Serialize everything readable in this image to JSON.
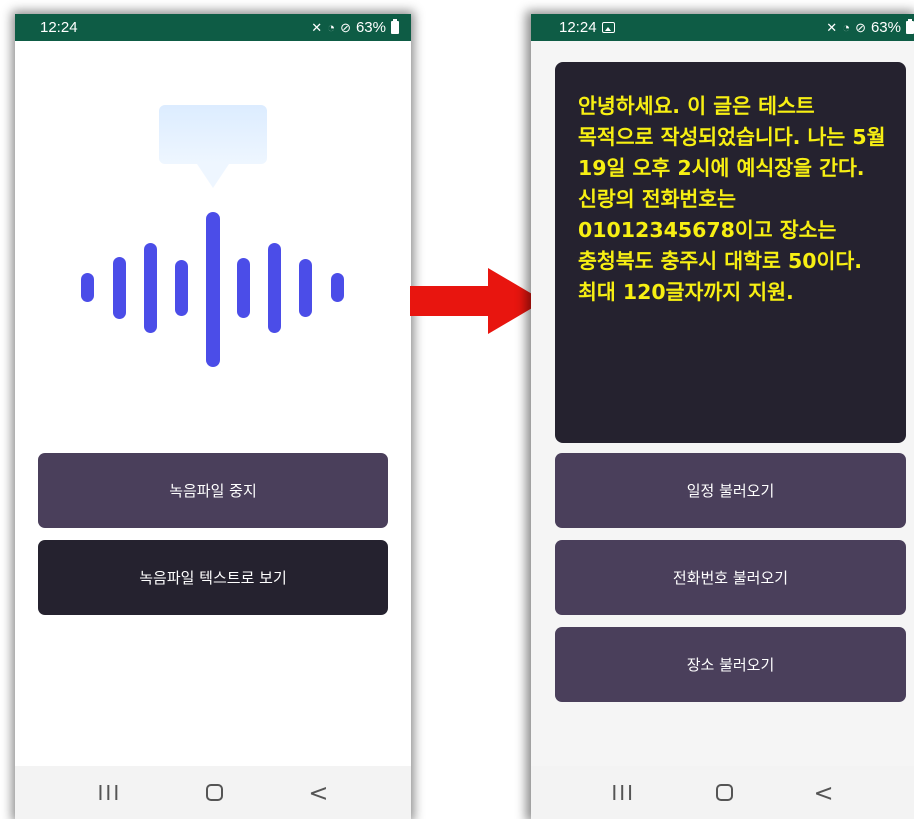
{
  "left_phone": {
    "status": {
      "time": "12:24",
      "battery": "63%"
    },
    "buttons": {
      "stop_recording": "녹음파일 중지",
      "view_as_text": "녹음파일 텍스트로 보기"
    },
    "nav": {
      "recent": "III",
      "back": "<"
    },
    "icons": [
      "mute-icon",
      "wifi-icon",
      "block-icon",
      "battery-icon",
      "speech-bubble-icon",
      "sound-wave-icon"
    ]
  },
  "right_phone": {
    "status": {
      "time": "12:24",
      "battery": "63%"
    },
    "transcript": "안녕하세요. 이 글은 테스트 목적으로 작성되었습니다. 나는 5월 19일 오후 2시에 예식장을 간다. 신랑의 전화번호는 01012345678이고 장소는 충청북도 충주시 대학로 50이다. 최대 120글자까지 지원.",
    "buttons": {
      "load_schedule": "일정 불러오기",
      "load_phone": "전화번호 불러오기",
      "load_place": "장소 불러오기"
    },
    "nav": {
      "recent": "III",
      "back": "<"
    }
  },
  "colors": {
    "statusbar": "#0e5c45",
    "button_primary": "#4a3f5b",
    "button_dark": "#25222f",
    "transcript_text": "#f7ef13",
    "arrow": "#e8150f",
    "wave_top": "#2fb4ff",
    "wave_bottom": "#4b4de8"
  }
}
